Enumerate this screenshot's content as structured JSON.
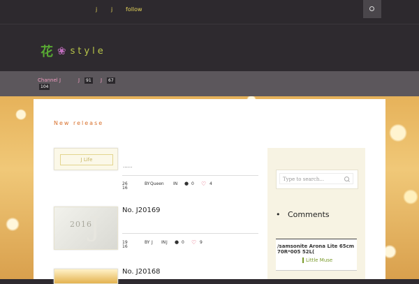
{
  "topbar": {
    "links": [
      "j",
      "j",
      "follow"
    ]
  },
  "header": {
    "logo_kanji": "花",
    "logo_flower": "❀",
    "logo_text": "style"
  },
  "nav": {
    "items": [
      {
        "label": "Channel J"
      },
      {
        "label": "J",
        "badge": "91"
      },
      {
        "label": "J",
        "badge": "67"
      }
    ],
    "extra_badge": "104"
  },
  "section_title": "New release",
  "posts": [
    {
      "thumb_label": "J Life",
      "title": "......",
      "date_day": "26",
      "date_year": "16",
      "by_label": "BY",
      "author": "Queen",
      "in_label": "IN",
      "category": "J",
      "comments": "0",
      "likes": "4"
    },
    {
      "thumb_year": "2016",
      "thumb_mark": "J",
      "title": "No. J20169",
      "date_day": "19",
      "date_year": "16",
      "by_label": "BY",
      "author": "J",
      "in_label": "IN",
      "category": "J",
      "comments": "0",
      "likes": "9"
    },
    {
      "title": "No. J20168"
    }
  ],
  "sidebar": {
    "search_placeholder": "Type to search...",
    "comments_title": "Comments",
    "comment_text": "/samsonite Arona Lite 65cm 70R*005 52L(",
    "comment_author": "Little Muse"
  },
  "colors": {
    "accent_orange": "#d86f2a",
    "nav_pink": "#f19cc0",
    "top_yellow": "#e3d35a",
    "green": "#7a9a2a"
  }
}
